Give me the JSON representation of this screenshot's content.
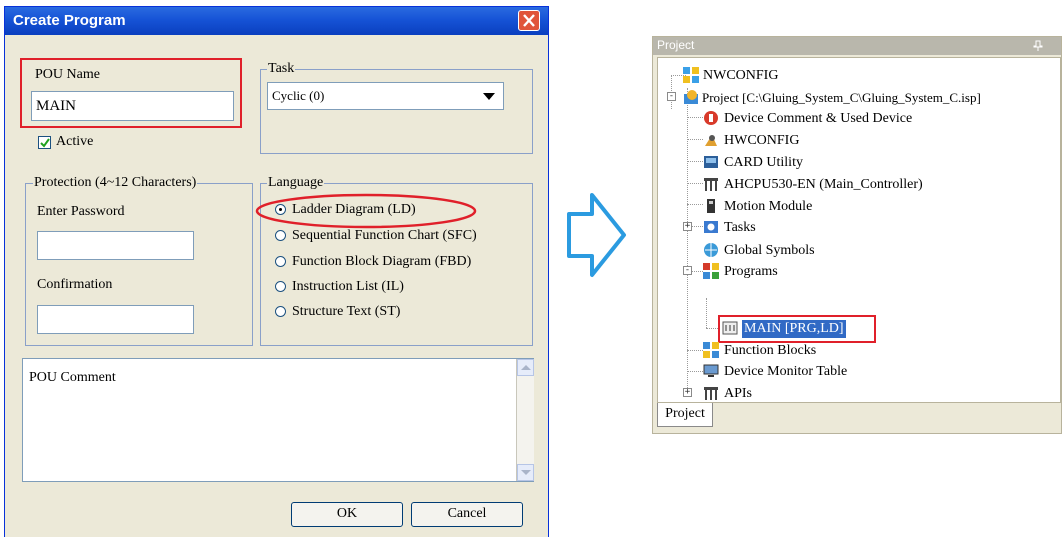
{
  "dialog": {
    "title": "Create Program",
    "pou_name_label": "POU Name",
    "pou_name_value": "MAIN",
    "active_label": "Active",
    "task_legend": "Task",
    "task_value": "Cyclic (0)",
    "protection_legend": "Protection (4~12 Characters)",
    "enter_password_label": "Enter Password",
    "confirmation_label": "Confirmation",
    "language_legend": "Language",
    "languages": [
      {
        "label": "Ladder Diagram (LD)",
        "selected": true
      },
      {
        "label": "Sequential Function Chart (SFC)",
        "selected": false
      },
      {
        "label": "Function Block Diagram (FBD)",
        "selected": false
      },
      {
        "label": "Instruction List (IL)",
        "selected": false
      },
      {
        "label": "Structure Text (ST)",
        "selected": false
      }
    ],
    "comment_placeholder": "POU Comment",
    "ok_label": "OK",
    "cancel_label": "Cancel"
  },
  "project": {
    "panel_title": "Project",
    "tab_label": "Project",
    "tree": [
      {
        "label": "NWCONFIG",
        "icon": "network-config-icon"
      },
      {
        "label": "Project [C:\\Gluing_System_C\\Gluing_System_C.isp]",
        "icon": "project-icon"
      },
      {
        "label": "Device Comment & Used Device",
        "icon": "device-comment-icon"
      },
      {
        "label": "HWCONFIG",
        "icon": "hardware-config-icon"
      },
      {
        "label": "CARD Utility",
        "icon": "card-utility-icon"
      },
      {
        "label": "AHCPU530-EN  (Main_Controller)",
        "icon": "cpu-icon"
      },
      {
        "label": "Motion Module",
        "icon": "motion-module-icon"
      },
      {
        "label": "Tasks",
        "icon": "tasks-icon"
      },
      {
        "label": "Global Symbols",
        "icon": "global-symbols-icon"
      },
      {
        "label": "Programs",
        "icon": "programs-icon"
      },
      {
        "label": "MAIN [PRG,LD]",
        "icon": "program-pou-icon"
      },
      {
        "label": "Function Blocks",
        "icon": "function-blocks-icon"
      },
      {
        "label": "Device Monitor Table",
        "icon": "device-monitor-icon"
      },
      {
        "label": "APIs",
        "icon": "apis-icon"
      }
    ]
  },
  "colors": {
    "title_bar": "#1653d6",
    "highlight_red": "#e0202a",
    "selection_blue": "#316ac5",
    "arrow_fill": "#ffffff",
    "arrow_stroke": "#2b9be0"
  }
}
